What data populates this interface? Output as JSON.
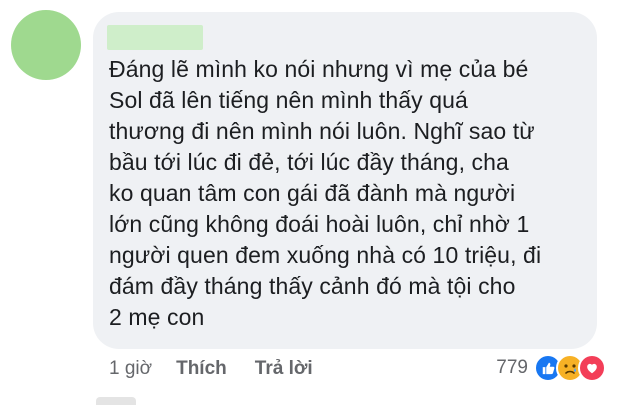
{
  "comment": {
    "lines": [
      "Đáng lẽ mình ko nói nhưng vì mẹ của bé",
      "Sol đã lên tiếng nên mình thấy quá",
      "thương đi nên mình nói luôn. Nghĩ sao từ",
      "bầu tới lúc đi đẻ, tới lúc đầy tháng, cha",
      "ko quan tâm con gái đã đành mà người",
      "lớn cũng không đoái hoài luôn, chỉ nhờ 1",
      "người quen đem xuống nhà có 10 triệu, đi",
      "đám đầy tháng thấy cảnh đó mà tội cho",
      "2 mẹ con"
    ]
  },
  "actions": {
    "time": "1 giờ",
    "like_label": "Thích",
    "reply_label": "Trả lời"
  },
  "reactions": {
    "count": "779",
    "icons": [
      "like-icon",
      "sad-icon",
      "love-icon"
    ]
  },
  "colors": {
    "bubble": "#eff1f4",
    "avatar": "#9fd98f",
    "like": "#1877f2",
    "sad": "#f7b125",
    "love": "#f33e58"
  }
}
